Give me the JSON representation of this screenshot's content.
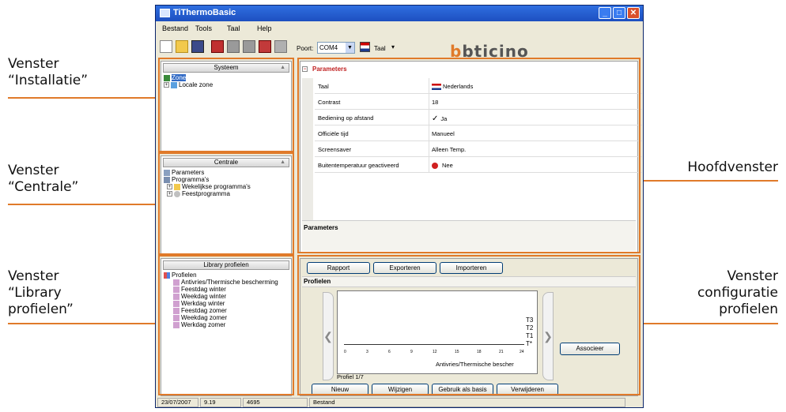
{
  "callouts": {
    "installatie": [
      "Venster",
      "“Installatie”"
    ],
    "centrale": [
      "Venster",
      "“Centrale”"
    ],
    "library": [
      "Venster",
      "“Library",
      "profielen”"
    ],
    "hoofdvenster": "Hoofdvenster",
    "configuratie": [
      "Venster",
      "configuratie",
      "profielen"
    ]
  },
  "colors": {
    "callout_accent": "#e07a2a",
    "titlebar": "#2158d0",
    "selection": "#316ac5"
  },
  "window": {
    "title": "TiThermoBasic",
    "controls": [
      "minimize-icon",
      "maximize-icon",
      "close-icon"
    ]
  },
  "menu": [
    "Bestand",
    "Tools",
    "Taal",
    "Help"
  ],
  "toolbar": {
    "port_label": "Poort:",
    "port_value": "COM4",
    "lang_label": "Taal",
    "brand": "bticino"
  },
  "systeem": {
    "header": "Systeem",
    "items": [
      {
        "label": "Zone",
        "icon": "zone-icon"
      },
      {
        "label": "Locale zone",
        "icon": "local-zone-icon"
      }
    ]
  },
  "centrale": {
    "header": "Centrale",
    "items": [
      {
        "label": "Parameters",
        "icon": "parameters-icon"
      },
      {
        "label": "Programma's",
        "icon": "programs-icon"
      },
      {
        "label": "Wekelijkse programma's",
        "icon": "folder-icon"
      },
      {
        "label": "Feestprogramma",
        "icon": "holiday-icon"
      }
    ]
  },
  "library": {
    "header": "Library profielen",
    "root": "Profielen",
    "items": [
      "Antivries/Thermische bescherming",
      "Feestdag winter",
      "Weekdag winter",
      "Werkdag winter",
      "Feestdag zomer",
      "Weekdag zomer",
      "Werkdag zomer"
    ]
  },
  "parameters": {
    "title": "Parameters",
    "rows": [
      {
        "key": "Taal",
        "value": "Nederlands",
        "icon": "dutch-flag-icon"
      },
      {
        "key": "Contrast",
        "value": "18",
        "icon": ""
      },
      {
        "key": "Bediening op afstand",
        "value": "Ja",
        "icon": "checkmark-icon"
      },
      {
        "key": "Officiële tijd",
        "value": "Manueel",
        "icon": ""
      },
      {
        "key": "Screensaver",
        "value": "Alleen Temp.",
        "icon": ""
      },
      {
        "key": "Buitentemperatuur geactiveerd",
        "value": "Nee",
        "icon": "no-entry-icon"
      }
    ],
    "description_title": "Parameters"
  },
  "profiles": {
    "buttons_top": [
      "Rapport",
      "Exporteren",
      "Importeren"
    ],
    "section_title": "Profielen",
    "levels": [
      "T3",
      "T2",
      "T1",
      "T*"
    ],
    "hours": [
      "0",
      "3",
      "6",
      "9",
      "12",
      "15",
      "18",
      "21",
      "24"
    ],
    "profile_name": "Antivries/Thermische bescher",
    "pager": "Profiel 1/7",
    "associate_button": "Associeer",
    "buttons_bottom": [
      "Nieuw",
      "Wijzigen",
      "Gebruik als basis",
      "Verwijderen"
    ]
  },
  "statusbar": {
    "date": "23/07/2007",
    "time": "9.19",
    "value": "4695",
    "file": "Bestand"
  }
}
